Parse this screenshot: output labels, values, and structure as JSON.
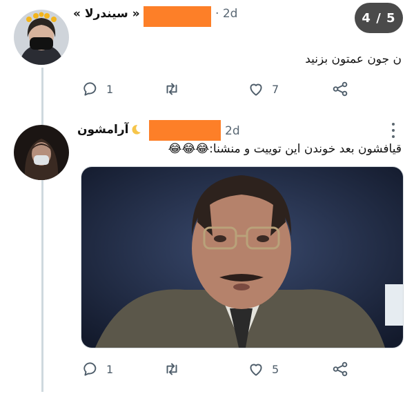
{
  "pager": {
    "label": "4 / 5"
  },
  "tweet1": {
    "name": "« سیندرلا »",
    "time": "2d",
    "text": "ن جون عمتون بزنید",
    "replies": "1",
    "likes": "7"
  },
  "tweet2": {
    "name": "آرامشون",
    "time": "2d",
    "text": "قیافشون بعد خوندن این توییت و منشنا:",
    "emoji": "😂😂😂",
    "replies": "1",
    "likes": "5"
  },
  "colors": {
    "redaction": "#fd7f28",
    "icons": "#4e5d6a",
    "pager_bg": "#4a4a4a"
  },
  "icons": [
    "reply-icon",
    "retweet-icon",
    "like-icon",
    "share-icon",
    "more-options-icon",
    "moon-icon"
  ]
}
